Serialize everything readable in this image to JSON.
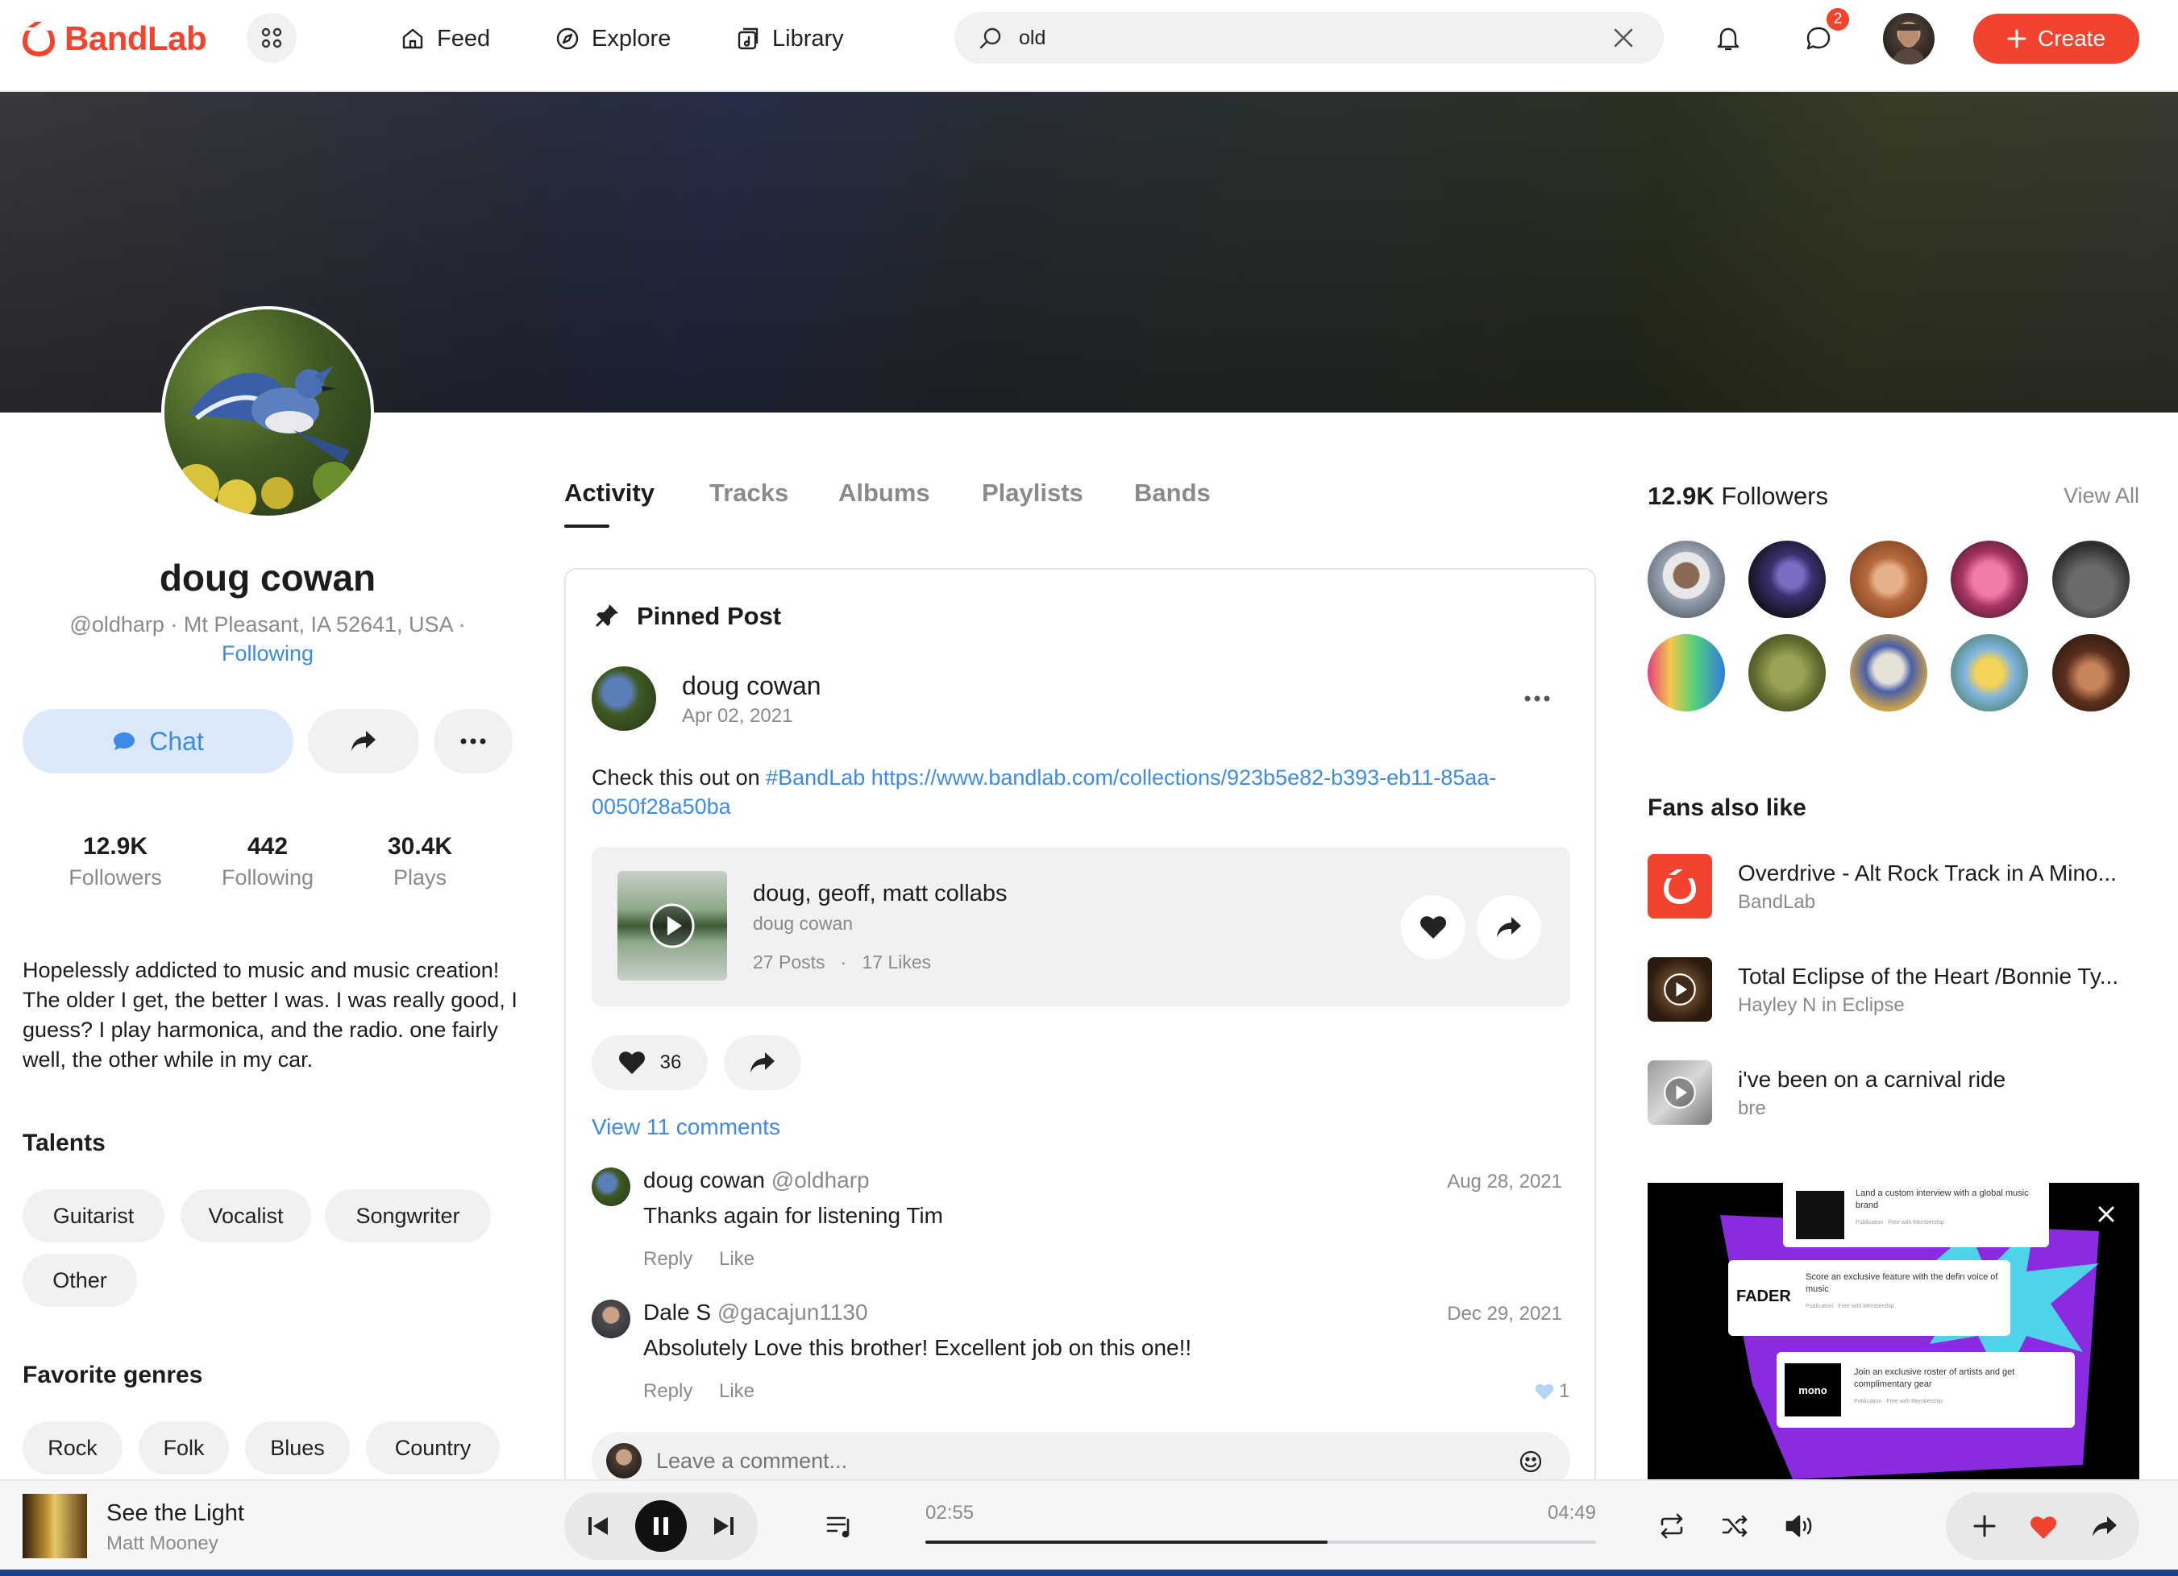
{
  "brand": {
    "name": "BandLab",
    "accent": "#f2432f",
    "link": "#3d8be6"
  },
  "nav": {
    "feed": "Feed",
    "explore": "Explore",
    "library": "Library"
  },
  "search": {
    "value": "old"
  },
  "header": {
    "messages_badge": "2",
    "create_label": "Create"
  },
  "profile": {
    "name": "doug cowan",
    "meta": "@oldharp · Mt Pleasant, IA 52641, USA ·",
    "following_status": "Following",
    "chat_label": "Chat",
    "stats": [
      {
        "value": "12.9K",
        "label": "Followers"
      },
      {
        "value": "442",
        "label": "Following"
      },
      {
        "value": "30.4K",
        "label": "Plays"
      }
    ],
    "bio": "Hopelessly addicted to music and music creation! The older I get, the better I was. I was really good, I guess? I play harmonica, and the radio. one fairly well, the other while in my car.",
    "talents_title": "Talents",
    "talents": [
      "Guitarist",
      "Vocalist",
      "Songwriter",
      "Other"
    ],
    "genres_title": "Favorite genres",
    "genres": [
      "Rock",
      "Folk",
      "Blues",
      "Country"
    ]
  },
  "tabs": [
    "Activity",
    "Tracks",
    "Albums",
    "Playlists",
    "Bands"
  ],
  "post": {
    "pinned_label": "Pinned Post",
    "author": "doug cowan",
    "date": "Apr 02, 2021",
    "text_prefix": "Check this out on",
    "hashtag": "#BandLab",
    "url": "https://www.bandlab.com/collections/923b5e82-b393-eb11-85aa-0050f28a50ba",
    "collection": {
      "title": "doug, geoff, matt collabs",
      "owner": "doug cowan",
      "posts": "27 Posts",
      "likes": "17 Likes"
    },
    "like_count": "36",
    "view_comments": "View 11 comments",
    "comments": [
      {
        "author": "doug cowan",
        "handle": "@oldharp",
        "date": "Aug 28, 2021",
        "text": "Thanks again for listening Tim",
        "reply": "Reply",
        "like": "Like",
        "likes": ""
      },
      {
        "author": "Dale S",
        "handle": "@gacajun1130",
        "date": "Dec 29, 2021",
        "text": "Absolutely Love this brother! Excellent job on this one!!",
        "reply": "Reply",
        "like": "Like",
        "likes": "1"
      }
    ],
    "comment_placeholder": "Leave a comment..."
  },
  "followers": {
    "count": "12.9K",
    "label": "Followers",
    "view_all": "View All"
  },
  "fans_also_like": {
    "title": "Fans also like",
    "items": [
      {
        "title": "Overdrive - Alt Rock Track in A Mino...",
        "subtitle": "BandLab"
      },
      {
        "title": "Total Eclipse of the Heart /Bonnie Ty...",
        "subtitle": "Hayley N in Eclipse"
      },
      {
        "title": "i've been on a carnival ride",
        "subtitle": "bre"
      }
    ]
  },
  "ad": {
    "card1": "Land a custom interview with a global music brand",
    "card1_sub": "Publication · Free with Membership",
    "card2": "Score an exclusive feature with the defin voice of music",
    "card2_sub": "Publication · Free with Membership",
    "card2_logo": "FADER",
    "card3": "Join an exclusive roster of artists and get complimentary gear",
    "card3_sub": "Publication · Free with Membership",
    "card3_logo": "mono"
  },
  "player": {
    "track": "See the Light",
    "artist": "Matt Mooney",
    "elapsed": "02:55",
    "duration": "04:49",
    "progress": 0.6
  }
}
